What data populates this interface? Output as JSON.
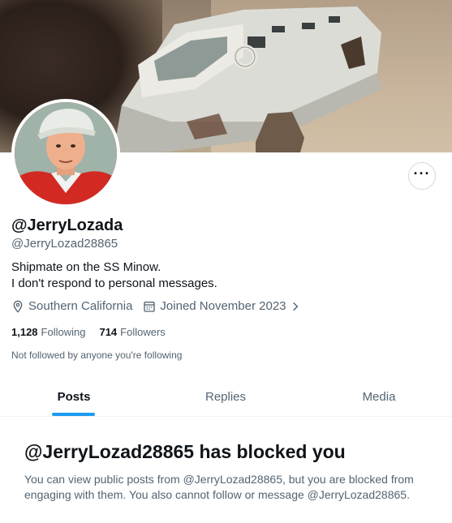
{
  "profile": {
    "display_name": "@JerryLozada",
    "handle": "@JerryLozad28865",
    "bio_lines": [
      "Shipmate on the SS Minow.",
      "I don't respond to personal messages."
    ],
    "location": "Southern California",
    "joined": "Joined November 2023",
    "following_count": "1,128",
    "following_label": "Following",
    "followers_count": "714",
    "followers_label": "Followers",
    "not_followed_note": "Not followed by anyone you're following"
  },
  "header": {
    "more_button_glyph": "···",
    "banner_icon": "boat-banner-image",
    "avatar_icon": "profile-avatar-image"
  },
  "icons": {
    "location": "location-pin-icon",
    "calendar": "calendar-icon",
    "chevron": "chevron-right-icon"
  },
  "tabs": [
    {
      "label": "Posts",
      "active": true
    },
    {
      "label": "Replies",
      "active": false
    },
    {
      "label": "Media",
      "active": false
    }
  ],
  "blocked": {
    "title": "@JerryLozad28865 has blocked you",
    "message": "You can view public posts from @JerryLozad28865, but you are blocked from engaging with them. You also cannot follow or message @JerryLozad28865."
  },
  "colors": {
    "accent": "#1d9bf0",
    "text_primary": "#0f1419",
    "text_secondary": "#536471",
    "border": "#cfd9de"
  }
}
